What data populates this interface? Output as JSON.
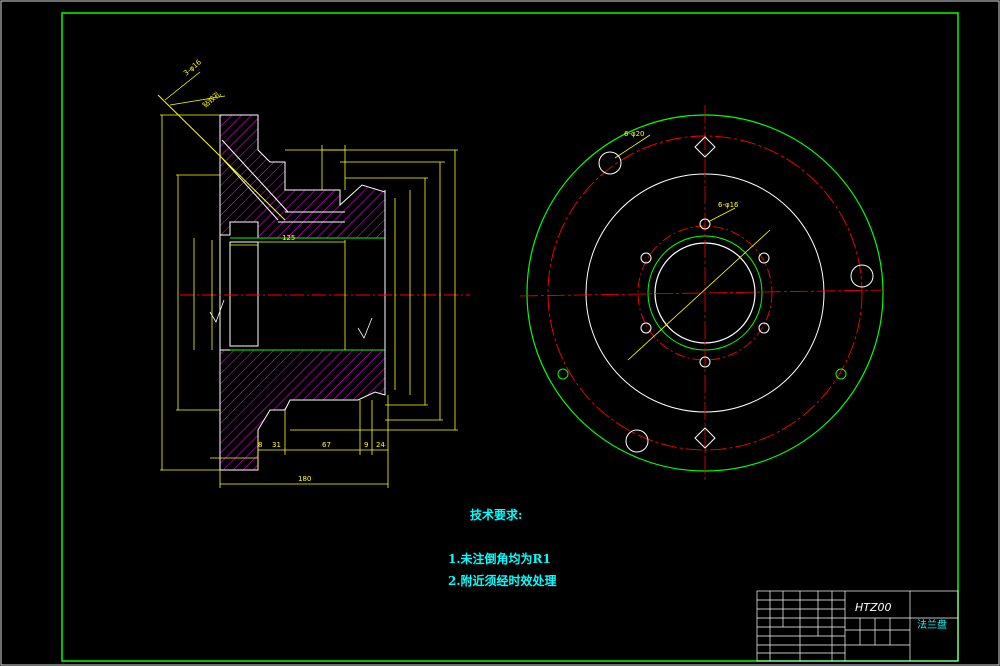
{
  "drawing": {
    "tech_title": "技术要求:",
    "notes": [
      "1.未注倒角均为R1",
      "2.附近须经时效处理"
    ],
    "title_block": {
      "material": "HTZ00",
      "part_name": "法兰盘"
    },
    "dimensions": {
      "oblique_hole": "3-φ16",
      "oblique_note": "钻铰孔",
      "bolt_holes_top": "6-φ20",
      "inner_holes": "6-φ16",
      "overall_len": "180",
      "len_67": "67",
      "len_31": "31",
      "len_24": "24",
      "len_9": "9",
      "len_8": "8",
      "bore_len": "125"
    },
    "colors": {
      "frame": "#00ff00",
      "dim": "#ffff00",
      "hatch": "#ff00ff",
      "center": "#ff0000",
      "text": "#00ffff",
      "outline": "#ffffff"
    }
  }
}
